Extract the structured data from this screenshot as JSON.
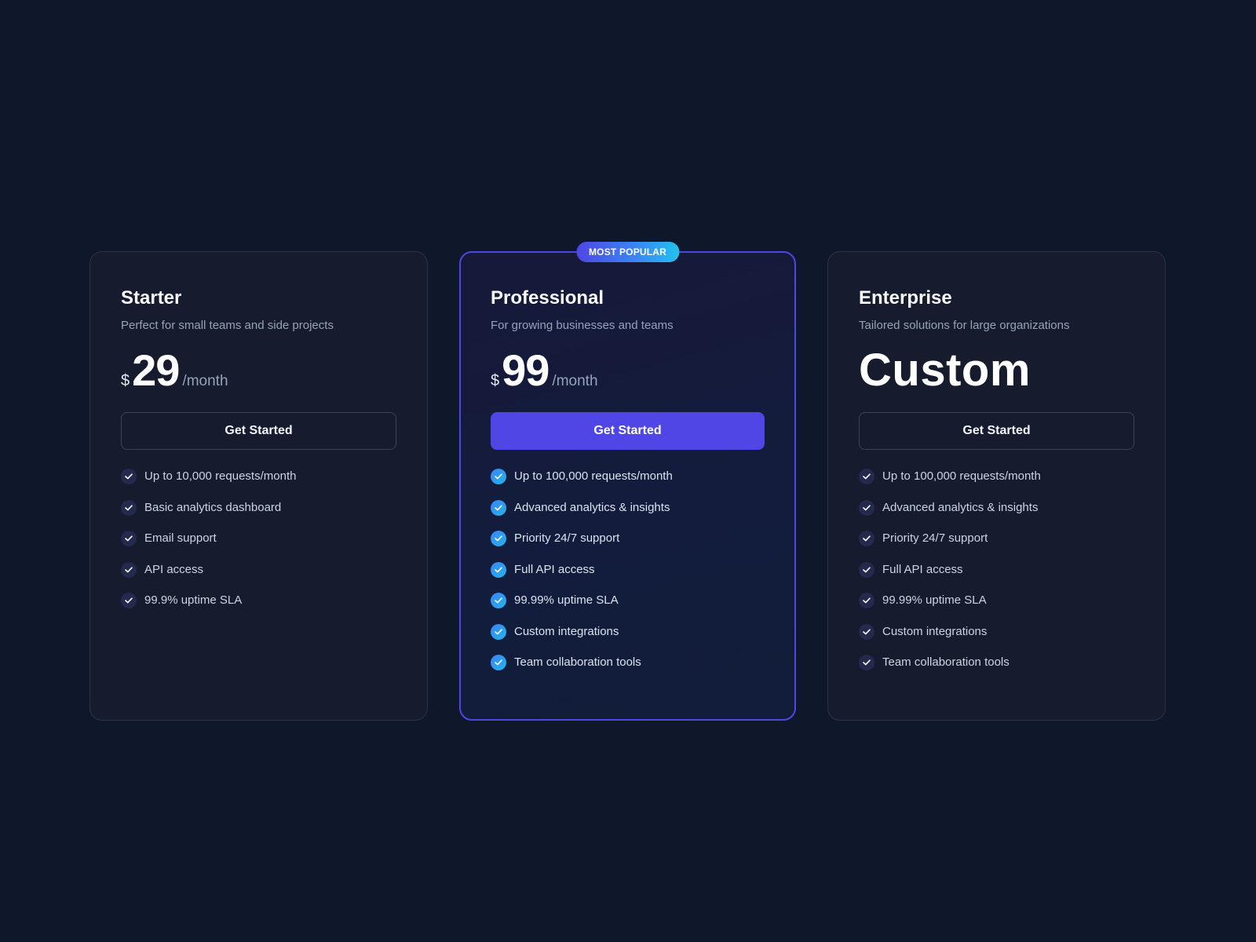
{
  "colors": {
    "background": "#0f172a",
    "card": "#161c2e",
    "accent": "#4f46e5",
    "check_featured": "#3b82f6"
  },
  "plans": [
    {
      "name": "Starter",
      "description": "Perfect for small teams and side projects",
      "currency": "$",
      "price": "29",
      "period": "/month",
      "cta": "Get Started",
      "features": [
        "Up to 10,000 requests/month",
        "Basic analytics dashboard",
        "Email support",
        "API access",
        "99.9% uptime SLA"
      ]
    },
    {
      "badge": "MOST POPULAR",
      "name": "Professional",
      "description": "For growing businesses and teams",
      "currency": "$",
      "price": "99",
      "period": "/month",
      "cta": "Get Started",
      "features": [
        "Up to 100,000 requests/month",
        "Advanced analytics & insights",
        "Priority 24/7 support",
        "Full API access",
        "99.99% uptime SLA",
        "Custom integrations",
        "Team collaboration tools"
      ]
    },
    {
      "name": "Enterprise",
      "description": "Tailored solutions for large organizations",
      "price": "Custom",
      "cta": "Get Started",
      "features": [
        "Up to 100,000 requests/month",
        "Advanced analytics & insights",
        "Priority 24/7 support",
        "Full API access",
        "99.99% uptime SLA",
        "Custom integrations",
        "Team collaboration tools"
      ]
    }
  ]
}
